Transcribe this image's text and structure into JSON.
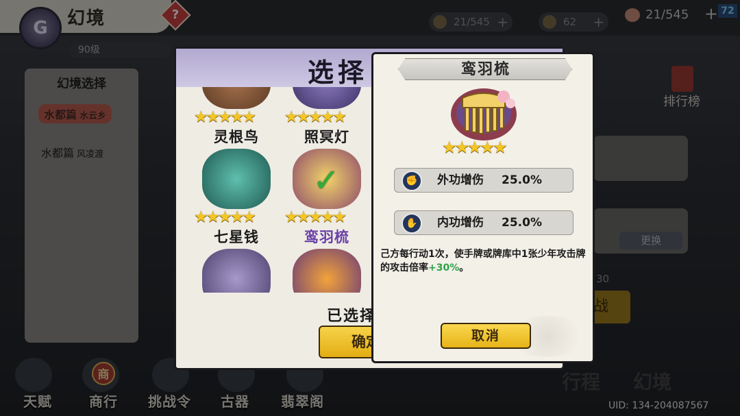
{
  "header": {
    "title": "幻境",
    "help_icon": "?",
    "level": "90级",
    "resources": [
      {
        "icon": "coin-icon",
        "value": "21/545"
      },
      {
        "icon": "gem-icon",
        "value": "62"
      }
    ],
    "stamina": "21/545",
    "notification_count": "72"
  },
  "sidebar": {
    "title": "幻境选择",
    "items": [
      {
        "label": "水都篇",
        "sub": "水云乡"
      },
      {
        "label": "水都篇",
        "sub": "风凌渡"
      }
    ]
  },
  "right_panel": {
    "rank_label": "排行榜",
    "switch_label": "更换",
    "count": "30",
    "action_label": "战"
  },
  "bottom_nav": [
    {
      "label": "天赋"
    },
    {
      "label": "商行",
      "badge": "商"
    },
    {
      "label": "挑战令"
    },
    {
      "label": "古器"
    },
    {
      "label": "翡翠阁"
    }
  ],
  "decor_words": [
    "行程",
    "幻境"
  ],
  "uid": "UID: 134-204087567",
  "select_dialog": {
    "title": "选择",
    "items": [
      {
        "name": "灵根鸟",
        "stars": "★★★★★",
        "color": "#8b5a3c"
      },
      {
        "name": "照冥灯",
        "stars": "★★★★★",
        "color": "#6a5b9c"
      },
      {
        "name": "七星钱",
        "stars": "★★★★★",
        "color": "#3d8b80"
      },
      {
        "name": "鸾羽梳",
        "stars": "★★★★★",
        "color": "#c9a62e",
        "selected": true
      },
      {
        "name": "",
        "stars": "",
        "color": "#7a6aa0"
      },
      {
        "name": "",
        "stars": "",
        "color": "#d48a2a"
      }
    ],
    "selected_label": "已选择",
    "confirm_label": "确定"
  },
  "detail": {
    "title": "鸾羽梳",
    "stars": "★★★★★",
    "stats": [
      {
        "icon": "fist-icon",
        "name": "外功增伤",
        "value": "25.0%"
      },
      {
        "icon": "palm-icon",
        "name": "内功增伤",
        "value": "25.0%"
      }
    ],
    "description": "己方每行动1次，使手牌或牌库中1张少年攻击牌的攻击倍率",
    "description_highlight": "+30%",
    "description_end": "。",
    "cancel_label": "取消"
  }
}
